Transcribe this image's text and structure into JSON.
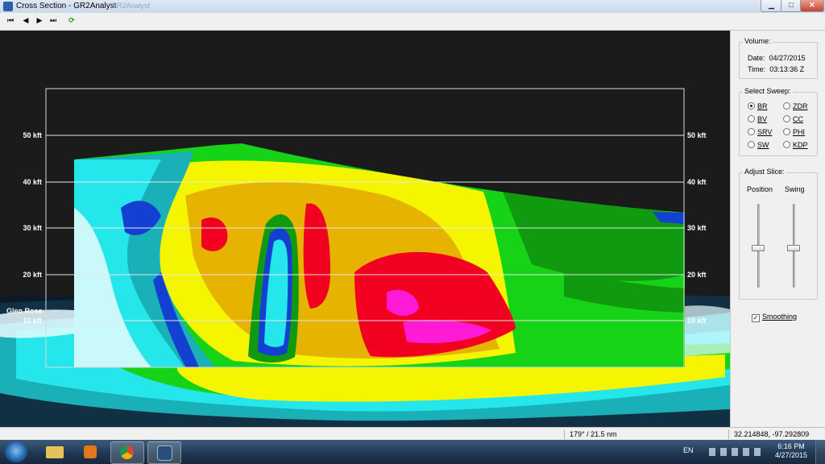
{
  "window": {
    "title": "Cross Section - GR2Analyst",
    "ghost_title": "GR2Analyst",
    "min_glyph": "▁",
    "max_glyph": "□",
    "close_glyph": "✕"
  },
  "toolbar": {
    "first_glyph": "⏮",
    "prev_glyph": "◀",
    "next_glyph": "▶",
    "last_glyph": "⏭",
    "refresh_glyph": "⟳"
  },
  "plot": {
    "alt_labels": [
      "50 kft",
      "40 kft",
      "30 kft",
      "20 kft",
      "10 kft"
    ],
    "place_label": "Glen Rose",
    "colors": {
      "white": "#e8fbff",
      "cyan": "#25e6ea",
      "teal": "#1ab0b8",
      "blue": "#1340d0",
      "green": "#17d317",
      "dgreen": "#109a10",
      "yellow": "#f5f500",
      "orange": "#e6b400",
      "red": "#f20020",
      "magenta": "#ff1ad6",
      "sky": "#1b1b1b",
      "ground": "#0a1a28"
    }
  },
  "panel": {
    "volume": {
      "title": "Volume:",
      "date_label": "Date:",
      "date": "04/27/2015",
      "time_label": "Time:",
      "time": "03:13:36 Z"
    },
    "sweep": {
      "title": "Select Sweep:",
      "options": [
        "BR",
        "BV",
        "SRV",
        "SW",
        "ZDR",
        "CC",
        "PHI",
        "KDP"
      ],
      "selected": "BR"
    },
    "slice": {
      "title": "Adjust Slice:",
      "position_label": "Position",
      "swing_label": "Swing"
    },
    "smoothing": {
      "label": "Smoothing",
      "checked": true,
      "mark": "✓"
    }
  },
  "status": {
    "cell1": "179° / 21.5 nm",
    "cell2": "32.214848, -97.292809"
  },
  "taskbar": {
    "lang": "EN",
    "time": "6:16 PM",
    "date": "4/27/2015"
  }
}
